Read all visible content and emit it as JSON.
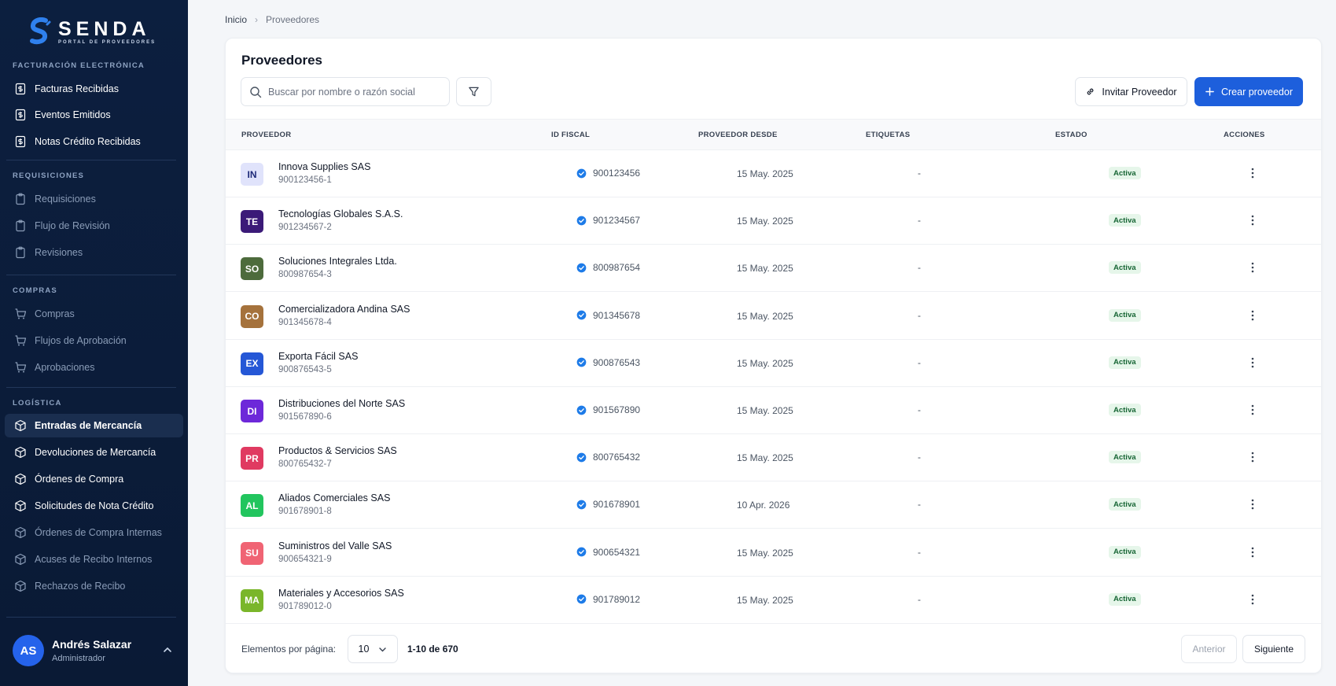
{
  "brand": {
    "name": "SENDA",
    "subtitle": "PORTAL DE PROVEEDORES",
    "color": "#2f80ed"
  },
  "sidebar": {
    "sections": [
      {
        "title": "FACTURACIÓN ELECTRÓNICA",
        "items": [
          {
            "label": "Facturas Recibidas",
            "icon": "receipt-icon",
            "state": "normal"
          },
          {
            "label": "Eventos Emitidos",
            "icon": "receipt-icon",
            "state": "normal"
          },
          {
            "label": "Notas Crédito Recibidas",
            "icon": "receipt-icon",
            "state": "normal"
          }
        ]
      },
      {
        "title": "REQUISICIONES",
        "items": [
          {
            "label": "Requisiciones",
            "icon": "clipboard-icon",
            "state": "dim"
          },
          {
            "label": "Flujo de Revisión",
            "icon": "clipboard-icon",
            "state": "dim"
          },
          {
            "label": "Revisiones",
            "icon": "clipboard-icon",
            "state": "dim"
          }
        ]
      },
      {
        "title": "COMPRAS",
        "items": [
          {
            "label": "Compras",
            "icon": "cart-icon",
            "state": "dim"
          },
          {
            "label": "Flujos de Aprobación",
            "icon": "cart-icon",
            "state": "dim"
          },
          {
            "label": "Aprobaciones",
            "icon": "cart-icon",
            "state": "dim"
          }
        ]
      },
      {
        "title": "LOGÍSTICA",
        "items": [
          {
            "label": "Entradas de Mercancía",
            "icon": "box-icon",
            "state": "active"
          },
          {
            "label": "Devoluciones de Mercancía",
            "icon": "box-icon",
            "state": "normal"
          },
          {
            "label": "Órdenes de Compra",
            "icon": "box-icon",
            "state": "normal"
          },
          {
            "label": "Solicitudes de Nota Crédito",
            "icon": "box-icon",
            "state": "normal"
          },
          {
            "label": "Órdenes de Compra Internas",
            "icon": "box-icon",
            "state": "dim"
          },
          {
            "label": "Acuses de Recibo Internos",
            "icon": "box-icon",
            "state": "dim"
          },
          {
            "label": "Rechazos de Recibo",
            "icon": "box-icon",
            "state": "dim"
          }
        ]
      }
    ]
  },
  "user": {
    "initials": "AS",
    "name": "Andrés Salazar",
    "role": "Administrador"
  },
  "breadcrumb": {
    "home": "Inicio",
    "current": "Proveedores"
  },
  "page": {
    "title": "Proveedores",
    "search_placeholder": "Buscar por nombre o razón social",
    "invite_label": "Invitar Proveedor",
    "create_label": "Crear proveedor",
    "accent_color": "#1d5fdc"
  },
  "table": {
    "headers": [
      "PROVEEDOR",
      "ID FISCAL",
      "PROVEEDOR DESDE",
      "ETIQUETAS",
      "ESTADO",
      "ACCIONES"
    ],
    "rows": [
      {
        "initials": "IN",
        "bg": "#e0e3fb",
        "fg": "#1e2a78",
        "name": "Innova Supplies SAS",
        "nit": "900123456-1",
        "fiscal": "900123456",
        "since": "15 May. 2025",
        "tags": "-",
        "status": "Activa"
      },
      {
        "initials": "TE",
        "bg": "#3b1a78",
        "fg": "#ffffff",
        "name": "Tecnologías Globales S.A.S.",
        "nit": "901234567-2",
        "fiscal": "901234567",
        "since": "15 May. 2025",
        "tags": "-",
        "status": "Activa"
      },
      {
        "initials": "SO",
        "bg": "#4d6b3c",
        "fg": "#ffffff",
        "name": "Soluciones Integrales Ltda.",
        "nit": "800987654-3",
        "fiscal": "800987654",
        "since": "15 May. 2025",
        "tags": "-",
        "status": "Activa"
      },
      {
        "initials": "CO",
        "bg": "#a5723c",
        "fg": "#ffffff",
        "name": "Comercializadora Andina SAS",
        "nit": "901345678-4",
        "fiscal": "901345678",
        "since": "15 May. 2025",
        "tags": "-",
        "status": "Activa"
      },
      {
        "initials": "EX",
        "bg": "#2557d6",
        "fg": "#ffffff",
        "name": "Exporta Fácil SAS",
        "nit": "900876543-5",
        "fiscal": "900876543",
        "since": "15 May. 2025",
        "tags": "-",
        "status": "Activa"
      },
      {
        "initials": "DI",
        "bg": "#6d28d9",
        "fg": "#ffffff",
        "name": "Distribuciones del Norte SAS",
        "nit": "901567890-6",
        "fiscal": "901567890",
        "since": "15 May. 2025",
        "tags": "-",
        "status": "Activa"
      },
      {
        "initials": "PR",
        "bg": "#e03a61",
        "fg": "#ffffff",
        "name": "Productos & Servicios SAS",
        "nit": "800765432-7",
        "fiscal": "800765432",
        "since": "15 May. 2025",
        "tags": "-",
        "status": "Activa"
      },
      {
        "initials": "AL",
        "bg": "#22c55e",
        "fg": "#ffffff",
        "name": "Aliados Comerciales SAS",
        "nit": "901678901-8",
        "fiscal": "901678901",
        "since": "10 Apr. 2026",
        "tags": "-",
        "status": "Activa"
      },
      {
        "initials": "SU",
        "bg": "#f06474",
        "fg": "#ffffff",
        "name": "Suministros del Valle SAS",
        "nit": "900654321-9",
        "fiscal": "900654321",
        "since": "15 May. 2025",
        "tags": "-",
        "status": "Activa"
      },
      {
        "initials": "MA",
        "bg": "#7ab62a",
        "fg": "#ffffff",
        "name": "Materiales y Accesorios SAS",
        "nit": "901789012-0",
        "fiscal": "901789012",
        "since": "15 May. 2025",
        "tags": "-",
        "status": "Activa"
      }
    ]
  },
  "pagination": {
    "per_page_label": "Elementos por página:",
    "per_page_value": "10",
    "range": "1-10 de 670",
    "prev_label": "Anterior",
    "next_label": "Siguiente"
  }
}
